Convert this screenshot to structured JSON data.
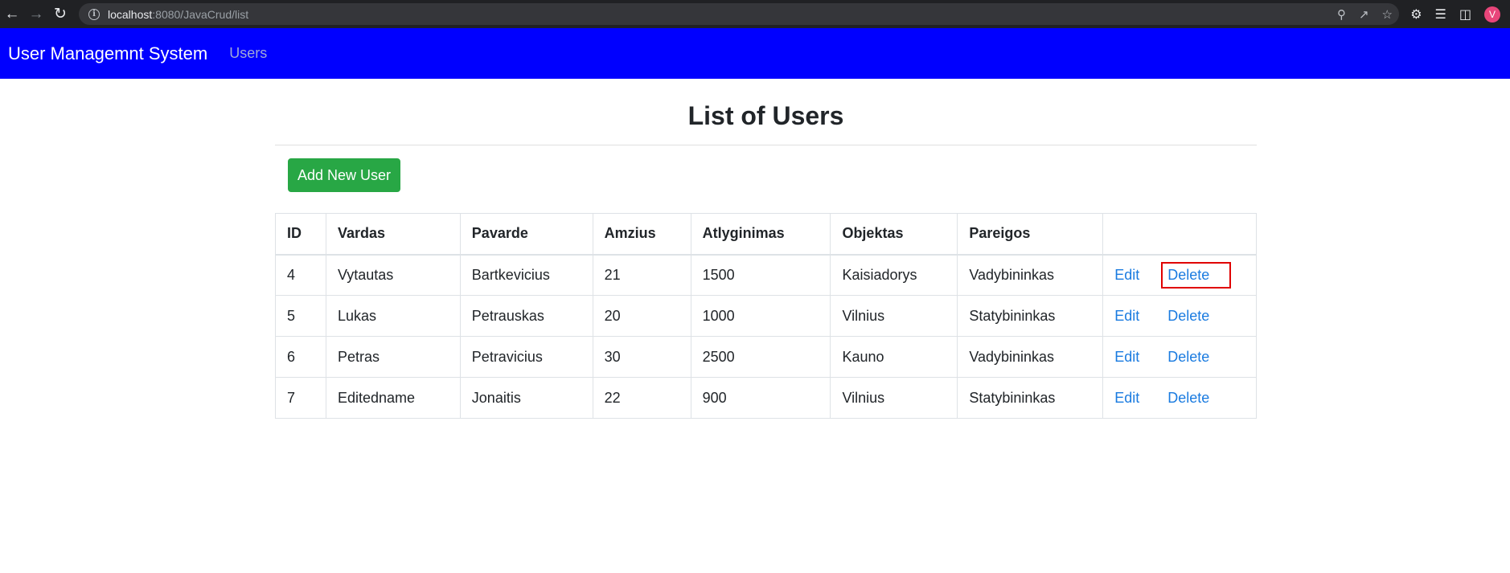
{
  "browser": {
    "url_host": "localhost",
    "url_rest": ":8080/JavaCrud/list",
    "profile_initial": "V"
  },
  "navbar": {
    "brand": "User Managemnt System",
    "link_users": "Users",
    "bg_color": "#0000ff"
  },
  "page": {
    "title": "List of Users",
    "add_button": "Add New User",
    "add_button_color": "#28a745"
  },
  "table": {
    "headers": [
      "ID",
      "Vardas",
      "Pavarde",
      "Amzius",
      "Atlyginimas",
      "Objektas",
      "Pareigos",
      ""
    ],
    "rows": [
      {
        "id": "4",
        "vardas": "Vytautas",
        "pavarde": "Bartkevicius",
        "amzius": "21",
        "atlyginimas": "1500",
        "objektas": "Kaisiadorys",
        "pareigos": "Vadybininkas",
        "edit": "Edit",
        "delete": "Delete"
      },
      {
        "id": "5",
        "vardas": "Lukas",
        "pavarde": "Petrauskas",
        "amzius": "20",
        "atlyginimas": "1000",
        "objektas": "Vilnius",
        "pareigos": "Statybininkas",
        "edit": "Edit",
        "delete": "Delete"
      },
      {
        "id": "6",
        "vardas": "Petras",
        "pavarde": "Petravicius",
        "amzius": "30",
        "atlyginimas": "2500",
        "objektas": "Kauno",
        "pareigos": "Vadybininkas",
        "edit": "Edit",
        "delete": "Delete"
      },
      {
        "id": "7",
        "vardas": "Editedname",
        "pavarde": "Jonaitis",
        "amzius": "22",
        "atlyginimas": "900",
        "objektas": "Vilnius",
        "pareigos": "Statybininkas",
        "edit": "Edit",
        "delete": "Delete"
      }
    ]
  },
  "icons": {
    "back": "arrow-left-icon",
    "forward": "arrow-right-icon",
    "reload": "reload-icon",
    "info": "info-icon",
    "zoom": "zoom-icon",
    "share": "share-icon",
    "bookmark": "star-icon",
    "extensions": "puzzle-icon",
    "reading_list": "reading-list-icon",
    "side_panel": "side-panel-icon"
  }
}
